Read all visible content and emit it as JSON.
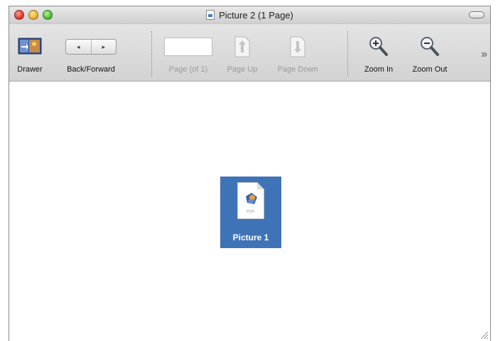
{
  "window": {
    "title": "Picture 2 (1 Page)"
  },
  "toolbar": {
    "drawer_label": "Drawer",
    "back_forward_label": "Back/Forward",
    "page_label": "Page (of 1)",
    "page_value": "",
    "page_up_label": "Page Up",
    "page_down_label": "Page Down",
    "zoom_in_label": "Zoom In",
    "zoom_out_label": "Zoom Out",
    "overflow_glyph": "»",
    "back_glyph": "◂",
    "forward_glyph": "▸"
  },
  "content": {
    "file_name": "Picture 1",
    "file_ext": "PDF"
  },
  "icons": {
    "traffic": [
      "close-icon",
      "minimize-icon",
      "zoom-icon"
    ],
    "toolbar": [
      "drawer-icon",
      "back-forward-icon",
      "page-up-icon",
      "page-down-icon",
      "zoom-in-icon",
      "zoom-out-icon"
    ]
  },
  "colors": {
    "selection": "#3f73b8",
    "label_disabled": "#9a9a9a"
  }
}
